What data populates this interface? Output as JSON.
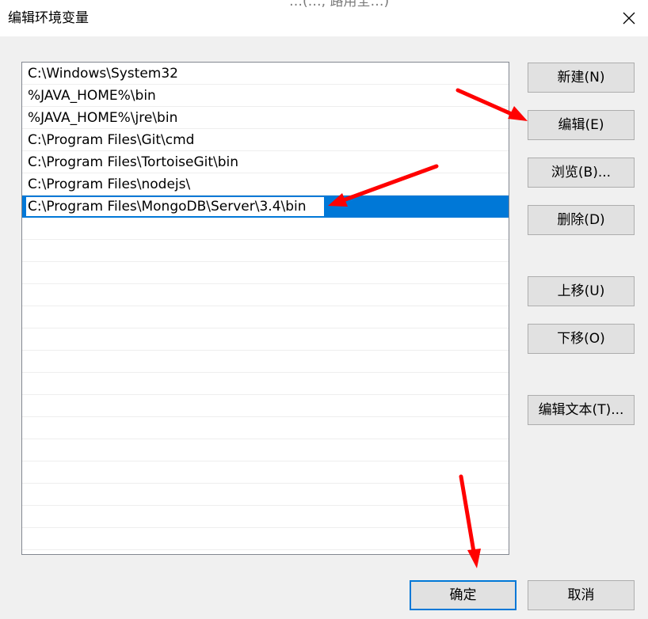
{
  "window": {
    "title": "编辑环境变量",
    "background_peek_text": "…(…, 路用全…)"
  },
  "paths": [
    "C:\\Windows\\System32",
    "%JAVA_HOME%\\bin",
    "%JAVA_HOME%\\jre\\bin",
    "C:\\Program Files\\Git\\cmd",
    "C:\\Program Files\\TortoiseGit\\bin",
    "C:\\Program Files\\nodejs\\"
  ],
  "editing_row": {
    "value": "C:\\Program Files\\MongoDB\\Server\\3.4\\bin"
  },
  "buttons": {
    "new": "新建(N)",
    "edit": "编辑(E)",
    "browse": "浏览(B)...",
    "delete": "删除(D)",
    "move_up": "上移(U)",
    "move_down": "下移(O)",
    "edit_text": "编辑文本(T)...",
    "ok": "确定",
    "cancel": "取消"
  },
  "colors": {
    "selection": "#0078d7",
    "annotation_arrow": "#ff0000",
    "dialog_background": "#f0f0f0"
  },
  "icons": {
    "close": "close-icon"
  }
}
